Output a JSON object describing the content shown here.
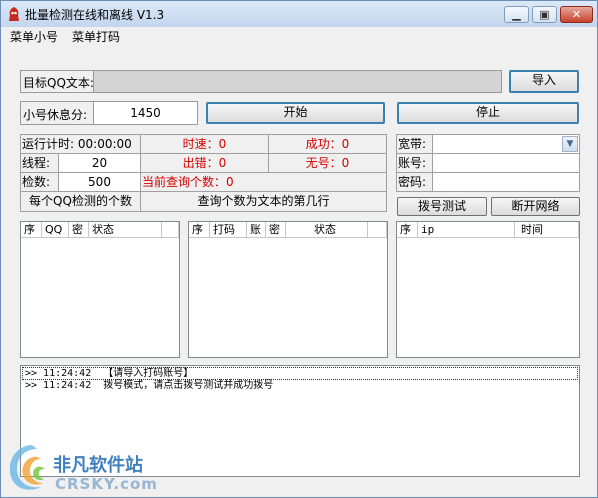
{
  "window": {
    "title": "批量检测在线和离线 V1.3",
    "min_icon": "minimize-icon",
    "max_icon": "maximize-icon",
    "close_icon": "close-icon"
  },
  "menu": {
    "item1": "菜单小号",
    "item2": "菜单打码"
  },
  "target": {
    "label": "目标QQ文本:",
    "value": "",
    "import_label": "导入"
  },
  "rest": {
    "label": "小号休息分:",
    "value": "1450"
  },
  "controls": {
    "start_label": "开始",
    "stop_label": "停止"
  },
  "stats": {
    "runtime_label": "运行计时:",
    "runtime_value": "00:00:00",
    "speed": "时速：0",
    "success": "成功：0",
    "threads_label": "线程:",
    "threads_value": "20",
    "errors": "出错：0",
    "no_account": "无号：0",
    "count_label": "检数:",
    "count_value": "500",
    "current_query": "当前查询个数：0",
    "hint1": "每个QQ检测的个数",
    "hint2": "查询个数为文本的第几行"
  },
  "network": {
    "broadband_label": "宽带:",
    "broadband_value": "",
    "account_label": "账号:",
    "account_value": "",
    "password_label": "密码:",
    "password_value": "",
    "dial_test_label": "拨号测试",
    "disconnect_label": "断开网络"
  },
  "table_left": {
    "columns": [
      "序",
      "QQ",
      "密",
      "状态",
      ""
    ]
  },
  "table_mid": {
    "columns": [
      "序",
      "打码",
      "账",
      "密",
      "状态",
      ""
    ]
  },
  "table_right": {
    "columns": [
      "序",
      "ip",
      "时间"
    ]
  },
  "log": {
    "lines": [
      ">> 11:24:42  【请导入打码账号】",
      ">> 11:24:42  拨号模式，请点击拨号测试并成功拨号"
    ]
  },
  "watermark": {
    "text1": "非凡软件站",
    "text2": "CRSKY.com"
  }
}
